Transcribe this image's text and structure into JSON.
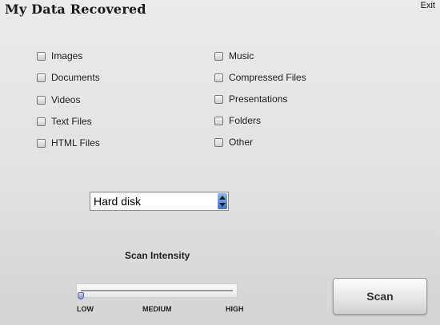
{
  "app": {
    "title": "My Data Recovered",
    "exit_label": "Exit"
  },
  "file_types": {
    "left": [
      {
        "label": "Images",
        "checked": false
      },
      {
        "label": "Documents",
        "checked": false
      },
      {
        "label": "Videos",
        "checked": false
      },
      {
        "label": "Text Files",
        "checked": false
      },
      {
        "label": "HTML Files",
        "checked": false
      }
    ],
    "right": [
      {
        "label": "Music",
        "checked": false
      },
      {
        "label": "Compressed Files",
        "checked": false
      },
      {
        "label": "Presentations",
        "checked": false
      },
      {
        "label": "Folders",
        "checked": false
      },
      {
        "label": "Other",
        "checked": false
      }
    ]
  },
  "drive_select": {
    "value": "Hard disk"
  },
  "scan_intensity": {
    "title": "Scan Intensity",
    "labels": [
      "LOW",
      "MEDIUM",
      "HIGH"
    ],
    "value": 0
  },
  "scan_button": {
    "label": "Scan"
  },
  "colors": {
    "select_arrow_accent": "#3c75d3",
    "slider_thumb": "#8191d6"
  }
}
